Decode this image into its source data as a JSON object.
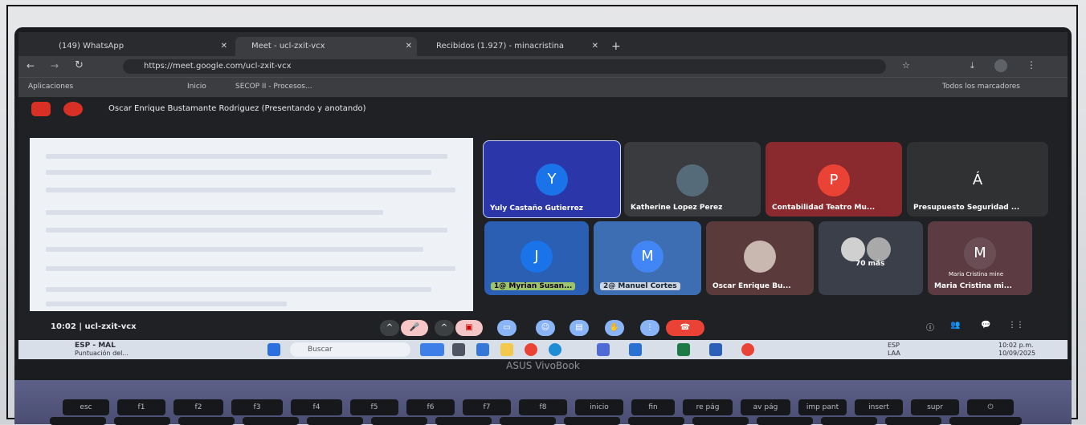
{
  "browser": {
    "tabs": [
      {
        "label": "(149) WhatsApp"
      },
      {
        "label": "Meet - ucl-zxit-vcx"
      },
      {
        "label": "Recibidos (1.927) - minacristina"
      }
    ],
    "new_tab": "+",
    "url": "https://meet.google.com/ucl-zxit-vcx",
    "bookmarks": [
      {
        "label": "Aplicaciones"
      },
      {
        "label": "Inicio"
      },
      {
        "label": "SECOP II - Procesos..."
      }
    ],
    "all_bookmarks": "Todos los marcadores"
  },
  "meet": {
    "presenter": "Oscar Enrique Bustamante Rodriguez (Presentando y anotando)",
    "meeting_time_code": "10:02 | ucl-zxit-vcx",
    "participants": [
      {
        "name": "Yuly Castaño Gutierrez",
        "initial": "Y",
        "color": "#1a73e8",
        "bg": "#2b37a8"
      },
      {
        "name": "Katherine Lopez Perez",
        "initial": "",
        "color": "#3c4043",
        "bg": "#3a3b3f"
      },
      {
        "name": "Contabilidad Teatro Mu...",
        "initial": "P",
        "color": "#ea4335",
        "bg": "#8a2a2e"
      },
      {
        "name": "Presupuesto Seguridad ...",
        "initial": "Á",
        "color": "#2f3133",
        "bg": "#2f3133"
      },
      {
        "name": "Myrian Susan...",
        "initial": "J",
        "color": "#1a73e8",
        "bg": "#2a5fb3"
      },
      {
        "name": "Manuel Cortes",
        "initial": "M",
        "color": "#4285f4",
        "bg": "#3d6db2"
      },
      {
        "name": "Oscar Enrique Bu...",
        "initial": "",
        "color": "#5f6368",
        "bg": "#5a3a3a"
      },
      {
        "name": "70 más",
        "initial": "",
        "color": "#5f6368",
        "bg": "#3b3f4a"
      },
      {
        "name": "Maria Cristina mi...",
        "initial": "M",
        "color": "#5f6368",
        "bg": "#5c3b42",
        "subtitle": "Maria Cristina mine"
      }
    ],
    "shared_badges": [
      "1@",
      "2@"
    ]
  },
  "taskbar": {
    "weather": "ESP - MAL",
    "weather_sub": "Puntuación del...",
    "search_placeholder": "Buscar",
    "lang": "ESP",
    "lang2": "LAA",
    "time": "10:02 p.m.",
    "date": "10/09/2025"
  },
  "laptop": {
    "brand": "ASUS VivoBook"
  },
  "keyboard": {
    "keys": [
      "esc",
      "f1",
      "f2",
      "f3",
      "f4",
      "f5",
      "f6",
      "f7",
      "f8",
      "inicio",
      "fin",
      "re pág",
      "av pág",
      "imp pant",
      "insert",
      "supr",
      "⏻"
    ]
  },
  "colors": {
    "accent": "#1a73e8",
    "end_call": "#ea4335"
  }
}
